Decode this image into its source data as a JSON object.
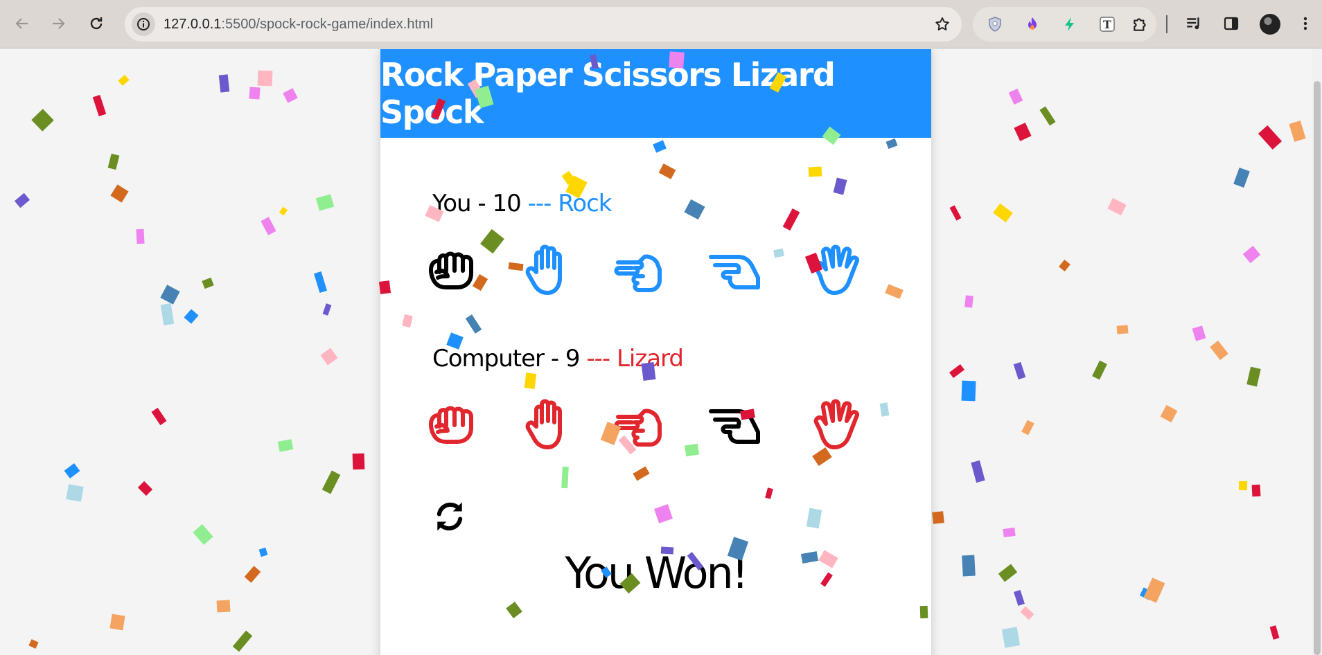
{
  "browser": {
    "url_host": "127.0.0.1",
    "url_rest": ":5500/spock-rock-game/index.html",
    "nav_icons": [
      "back-arrow-icon",
      "forward-arrow-icon",
      "reload-icon"
    ],
    "omnibox_icons": [
      "site-info-icon",
      "bookmark-star-icon"
    ],
    "extensions": [
      "shield-extension-icon",
      "flame-extension-icon",
      "lightning-extension-icon",
      "font-t-extension-icon",
      "puzzle-extensions-icon"
    ],
    "toolbar": [
      "media-playlist-icon",
      "side-panel-icon",
      "profile-avatar",
      "more-menu-icon"
    ]
  },
  "game": {
    "title": "Rock Paper Scissors Lizard Spock",
    "player": {
      "label": "You - ",
      "score": "10",
      "separator": " --- ",
      "choice": "Rock",
      "color": "#1e90ff",
      "selected_index": 0
    },
    "computer": {
      "label": "Computer - ",
      "score": "9",
      "separator": " --- ",
      "choice": "Lizard",
      "color": "#e1262d",
      "selected_index": 3
    },
    "hands": [
      "rock-hand-icon",
      "paper-hand-icon",
      "scissors-hand-icon",
      "lizard-hand-icon",
      "spock-hand-icon"
    ],
    "reset_icon": "sync-arrows-icon",
    "result": "You Won!"
  },
  "confetti_colors": [
    "#6b8e23",
    "#4682b4",
    "#90ee90",
    "#add8e6",
    "#dc143c",
    "#f4a460",
    "#ffb6c1",
    "#ffd700",
    "#6a5acd",
    "#1e90ff",
    "#d2691e",
    "#ee82ee"
  ]
}
